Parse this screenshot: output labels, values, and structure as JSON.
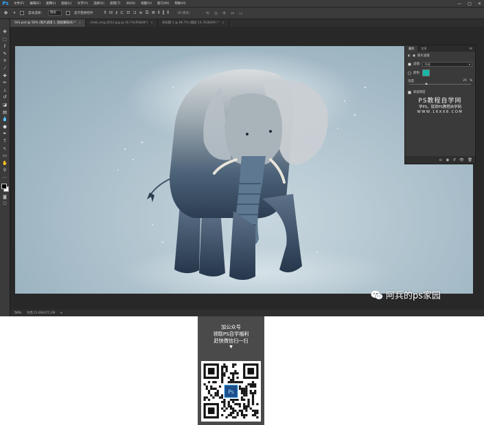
{
  "app": {
    "logo": "Ps"
  },
  "menu": [
    "文件(F)",
    "编辑(E)",
    "图像(I)",
    "图层(L)",
    "文字(Y)",
    "选择(S)",
    "滤镜(T)",
    "3D(D)",
    "视图(V)",
    "窗口(W)",
    "帮助(H)"
  ],
  "window_controls": [
    "—",
    "□",
    "✕"
  ],
  "options": {
    "auto_select_label": "自动选择：",
    "auto_select_value": "图层",
    "show_transform_label": "显示变换控件",
    "mode3d_label": "3D 模式："
  },
  "tabs": [
    {
      "label": "503.psd @ 50% (照片滤镜 1, 图层蒙版/8) *",
      "active": true,
      "close": "×"
    },
    {
      "label": "chalk_img_0012.jpg @ 16.7%(RGB/8*)",
      "active": false,
      "close": "×"
    },
    {
      "label": "未标题-1 @ 66.7% (图层 14, RGB/8#) *",
      "active": false,
      "close": "×"
    }
  ],
  "status": {
    "zoom": "50%",
    "doc": "文档:13.4M/471.2M",
    "arrow": "▸"
  },
  "panel": {
    "tabs": [
      "属性",
      "信息"
    ],
    "menu_icon": "≡",
    "adjustment_title": "照片滤镜",
    "filter_label": "滤镜:",
    "filter_value": "冷却",
    "color_label": "颜色:",
    "color_value": "#14b8a6",
    "density_label": "浓度:",
    "density_value": "25",
    "density_unit": "%",
    "density_level": 0.25,
    "preserve_label": "保留明度",
    "watermark": {
      "title": "PS教程自学网",
      "subtitle": "学PS，就到PS教程自学网",
      "url": "WWW.16XX8.COM"
    }
  },
  "canvas_watermark": {
    "text": "阿兵的ps家园"
  },
  "qr_card": {
    "line1": "加公众号",
    "line2": "领取PS自学福利",
    "line3": "赶快微信扫一扫",
    "arrow": "▼",
    "center_logo": "Ps"
  }
}
